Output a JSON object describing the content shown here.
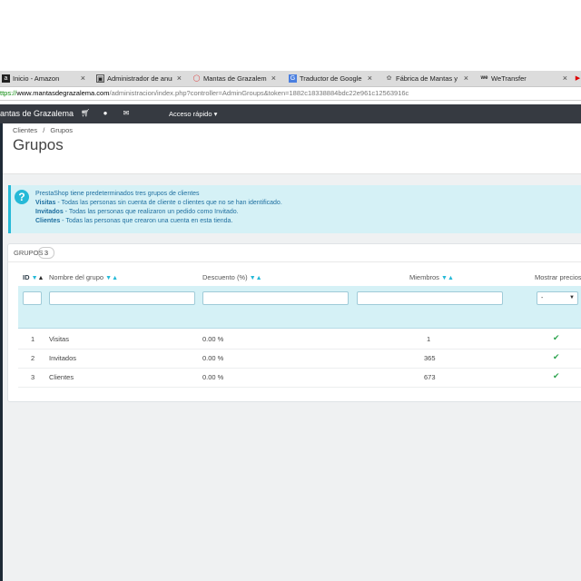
{
  "browser": {
    "tabs": [
      {
        "label": "Inicio - Amazon",
        "icon": "amazon-a-icon"
      },
      {
        "label": "Administrador de anun",
        "icon": "ad-manager-icon"
      },
      {
        "label": "Mantas de Grazalema -",
        "icon": "opera-o-icon"
      },
      {
        "label": "Traductor de Google",
        "icon": "translate-icon"
      },
      {
        "label": "Fábrica de Mantas y Bu",
        "icon": "factory-icon"
      },
      {
        "label": "WeTransfer",
        "icon": "wetransfer-icon"
      }
    ],
    "url": {
      "scheme": "ttps://",
      "domain": "www.mantasdegrazalema.com",
      "path": "/administracion/index.php?controller=AdminGroups&token=1882c18338884bdc22e961c12563916c"
    }
  },
  "topnav": {
    "brand": "antas de Grazalema",
    "quick_access": "Acceso rápido ▾"
  },
  "breadcrumb": {
    "item1": "Clientes",
    "sep": "/",
    "item2": "Grupos"
  },
  "page_title": "Grupos",
  "alert": {
    "title": "PrestaShop tiene predeterminados tres grupos de clientes",
    "lines": [
      {
        "bold": "Visitas",
        "text": " - Todas las personas sin cuenta de cliente o clientes que no se han identificado."
      },
      {
        "bold": "Invitados",
        "text": " - Todas las personas que realizaron un pedido como Invitado."
      },
      {
        "bold": "Clientes",
        "text": " - Todas las personas que crearon una cuenta en esta tienda."
      }
    ]
  },
  "panel": {
    "title": "GRUPOS",
    "count": "3",
    "columns": {
      "id": "ID",
      "name": "Nombre del grupo",
      "discount": "Descuento (%)",
      "members": "Miembros",
      "show_prices": "Mostrar precios"
    },
    "filter_select_value": "-",
    "rows": [
      {
        "id": "1",
        "name": "Visitas",
        "discount": "0.00 %",
        "members": "1"
      },
      {
        "id": "2",
        "name": "Invitados",
        "discount": "0.00 %",
        "members": "365"
      },
      {
        "id": "3",
        "name": "Clientes",
        "discount": "0.00 %",
        "members": "673"
      }
    ]
  },
  "colors": {
    "accent": "#25b9d7",
    "nav_bg": "#363a41",
    "check": "#2ea44f"
  }
}
